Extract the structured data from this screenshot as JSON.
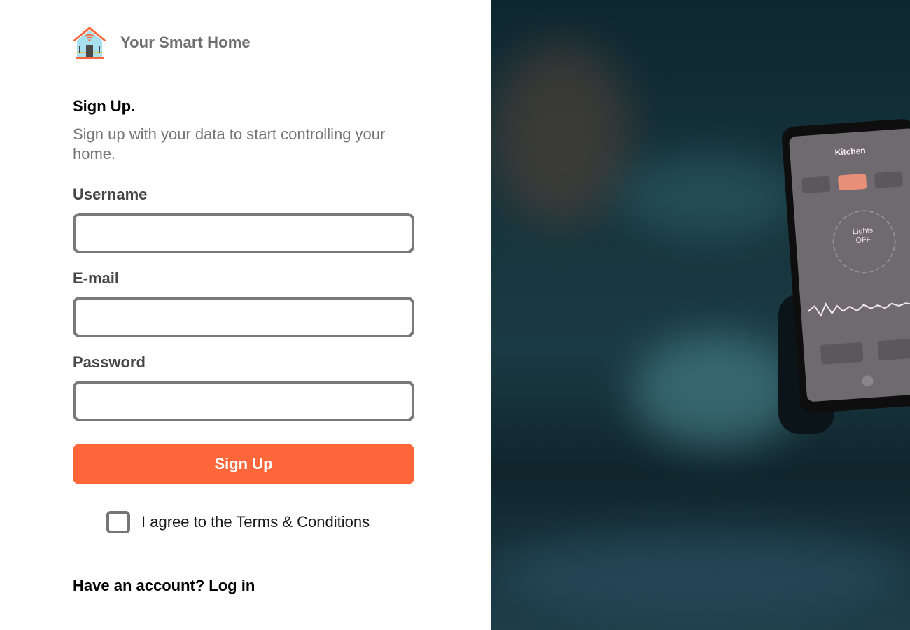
{
  "brand": {
    "name": "Your Smart Home",
    "logo_icon": "house-icon"
  },
  "form": {
    "heading": "Sign Up.",
    "subtitle": "Sign up with your data to start controlling your home.",
    "username_label": "Username",
    "username_value": "",
    "email_label": "E-mail",
    "email_value": "",
    "password_label": "Password",
    "password_value": "",
    "submit_label": "Sign Up",
    "terms_label": "I agree to the Terms & Conditions",
    "terms_checked": false,
    "account_prompt": "Have an account?",
    "login_label": "Log in"
  },
  "hero": {
    "screen_title": "Kitchen",
    "lights_line1": "Lights",
    "lights_line2": "OFF"
  },
  "colors": {
    "accent": "#ff6639",
    "field_border": "#7a7a7a",
    "muted_text": "#767676"
  }
}
